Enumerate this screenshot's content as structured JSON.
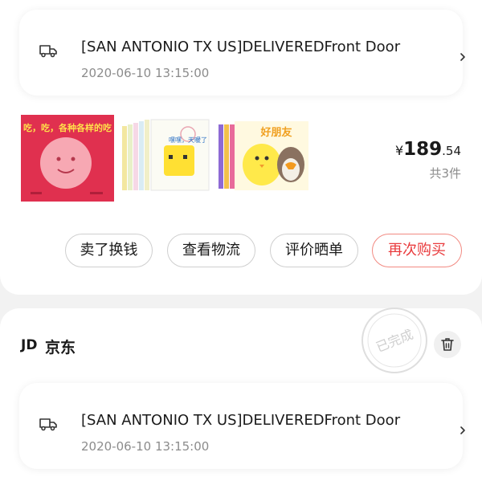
{
  "orders": [
    {
      "tracking": {
        "status_text": "[SAN ANTONIO TX US]DELIVEREDFront Door",
        "timestamp": "2020-06-10 13:15:00"
      },
      "products": [
        {
          "cover_title": "吃，吃，各种各样的吃"
        },
        {
          "cover_title": "嘿嘿，天暖了"
        },
        {
          "cover_title": "好朋友"
        }
      ],
      "price": {
        "currency": "¥",
        "integer": "189",
        "decimal": ".54"
      },
      "item_count": "共3件",
      "actions": {
        "sell": "卖了换钱",
        "logistics": "查看物流",
        "review": "评价晒单",
        "rebuy": "再次购买"
      }
    },
    {
      "store": {
        "logo_text": "JD",
        "name": "京东"
      },
      "stamp_text": "已完成",
      "tracking": {
        "status_text": "[SAN ANTONIO TX US]DELIVEREDFront Door",
        "timestamp": "2020-06-10 13:15:00"
      }
    }
  ],
  "icons": {
    "truck": "truck-icon",
    "chevron": "chevron-right-icon",
    "trash": "trash-icon"
  },
  "colors": {
    "accent": "#e93b3d",
    "muted_text": "#8c8c8c",
    "background": "#f2f2f2"
  }
}
